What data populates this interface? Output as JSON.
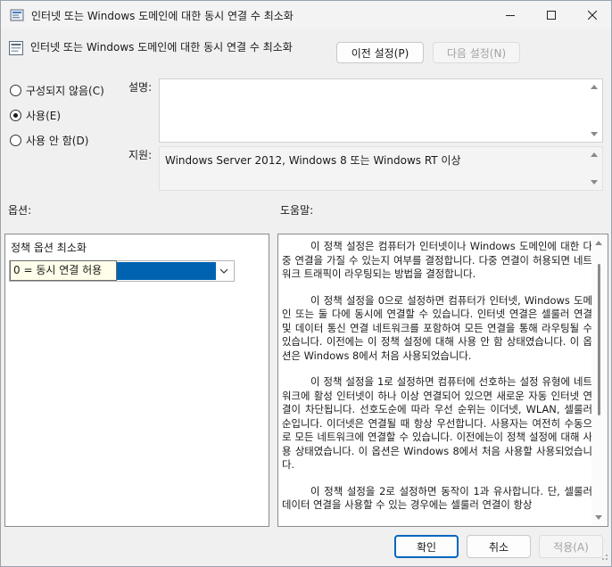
{
  "window": {
    "title": "인터넷 또는 Windows 도메인에 대한 동시 연결 수 최소화"
  },
  "header": {
    "title": "인터넷 또는 Windows 도메인에 대한 동시 연결 수 최소화",
    "prev_button": "이전 설정(P)",
    "next_button": "다음 설정(N)"
  },
  "state_options": [
    {
      "label": "구성되지 않음(C)",
      "selected": false
    },
    {
      "label": "사용(E)",
      "selected": true
    },
    {
      "label": "사용 안 함(D)",
      "selected": false
    }
  ],
  "comment": {
    "label": "설명:",
    "value": ""
  },
  "supported": {
    "label": "지원:",
    "value": "Windows Server 2012, Windows 8 또는 Windows RT 이상"
  },
  "options": {
    "section_label": "옵션:",
    "policy_label": "정책 옵션 최소화",
    "dropdown_value": "0 = 동시 연결 허용",
    "selection_color": "#0063b1"
  },
  "help": {
    "section_label": "도움말:",
    "paragraphs": [
      "이 정책 설정은 컴퓨터가 인터넷이나 Windows 도메인에 대한 다중 연결을 가질 수 있는지 여부를 결정합니다. 다중 연결이 허용되면 네트워크 트래픽이 라우팅되는 방법을 결정합니다.",
      "이 정책 설정을 0으로 설정하면 컴퓨터가 인터넷, Windows 도메인 또는 둘 다에 동시에 연결할 수 있습니다. 인터넷 연결은 셀룰러 연결 및 데이터 통신 연결 네트워크를 포함하여 모든 연결을 통해 라우팅될 수 있습니다. 이전에는 이 정책 설정에 대해 사용 안 함 상태였습니다. 이 옵션은 Windows 8에서 처음 사용되었습니다.",
      "이 정책 설정을 1로 설정하면 컴퓨터에 선호하는 설정 유형에 네트워크에 활성 인터넷이 하나 이상 연결되어 있으면 새로운 자동 인터넷 연결이 차단됩니다. 선호도순에 따라 우선 순위는 이더넷, WLAN, 셀룰러 순입니다. 이더넷은 연결될 때 항상 우선합니다. 사용자는 여전히 수동으로 모든 네트워크에 연결할 수 있습니다. 이전에는이 정책 설정에 대해 사용 상태였습니다. 이 옵션은 Windows 8에서 처음 사용할 사용되었습니다.",
      "이 정책 설정을 2로 설정하면 동작이 1과 유사합니다. 단, 셀룰러 데이터 연결을 사용할 수 있는 경우에는 셀룰러 연결이 항상"
    ]
  },
  "footer": {
    "ok": "확인",
    "cancel": "취소",
    "apply": "적용(A)"
  }
}
